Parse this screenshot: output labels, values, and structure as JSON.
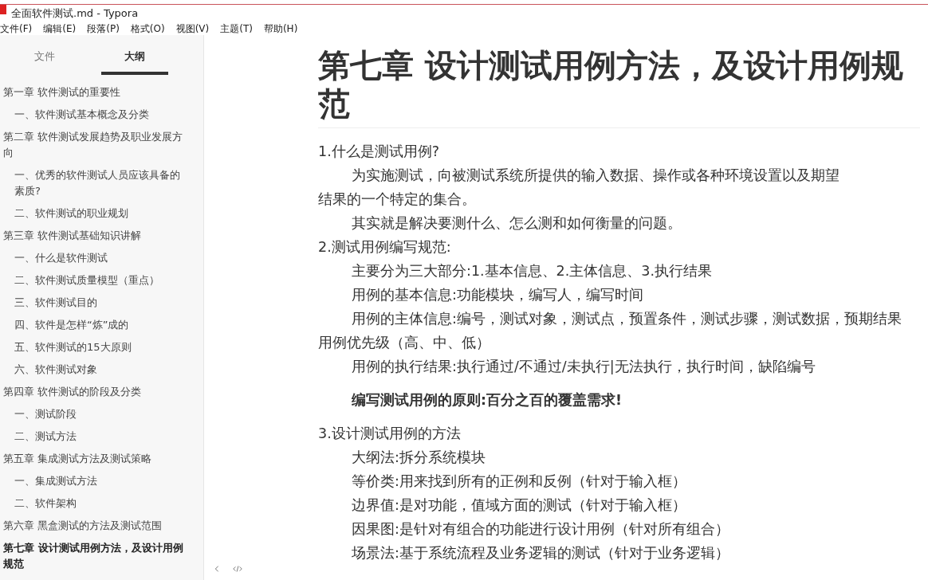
{
  "window": {
    "title": "全面软件测试.md - Typora"
  },
  "menu": [
    "文件(F)",
    "编辑(E)",
    "段落(P)",
    "格式(O)",
    "视图(V)",
    "主题(T)",
    "帮助(H)"
  ],
  "sidebar": {
    "tabs": [
      {
        "label": "文件",
        "selected": false
      },
      {
        "label": "大纲",
        "selected": true
      }
    ],
    "outline": [
      {
        "text": "第一章 软件测试的重要性",
        "selected": false,
        "children": [
          {
            "text": "一、软件测试基本概念及分类",
            "selected": false
          }
        ]
      },
      {
        "text": "第二章 软件测试发展趋势及职业发展方向",
        "selected": false,
        "children": [
          {
            "text": "一、优秀的软件测试人员应该具备的素质?",
            "selected": false
          },
          {
            "text": "二、软件测试的职业规划",
            "selected": false
          }
        ]
      },
      {
        "text": "第三章 软件测试基础知识讲解",
        "selected": false,
        "children": [
          {
            "text": "一、什么是软件测试",
            "selected": false
          },
          {
            "text": "二、软件测试质量模型（重点）",
            "selected": false
          },
          {
            "text": "三、软件测试目的",
            "selected": false
          },
          {
            "text": "四、软件是怎样“炼”成的",
            "selected": false
          },
          {
            "text": "五、软件测试的15大原则",
            "selected": false
          },
          {
            "text": "六、软件测试对象",
            "selected": false
          }
        ]
      },
      {
        "text": "第四章 软件测试的阶段及分类",
        "selected": false,
        "children": [
          {
            "text": "一、测试阶段",
            "selected": false
          },
          {
            "text": "二、测试方法",
            "selected": false
          }
        ]
      },
      {
        "text": "第五章 集成测试方法及测试策略",
        "selected": false,
        "children": [
          {
            "text": "一、集成测试方法",
            "selected": false
          },
          {
            "text": "二、软件架构",
            "selected": false
          }
        ]
      },
      {
        "text": "第六章 黑盒测试的方法及测试范围",
        "selected": false
      },
      {
        "text": "第七章 设计测试用例方法，及设计用例规范",
        "selected": true
      }
    ]
  },
  "document": {
    "heading": "第七章 设计测试用例方法，及设计用例规范",
    "lines": [
      {
        "text": "1.什么是测试用例?",
        "kind": "plain"
      },
      {
        "text": "为实施测试，向被测试系统所提供的输入数据、操作或各种环境设置以及期望",
        "kind": "indent"
      },
      {
        "text": "结果的一个特定的集合。",
        "kind": "plain"
      },
      {
        "text": "其实就是解决要测什么、怎么测和如何衡量的问题。",
        "kind": "indent"
      },
      {
        "text": "2.测试用例编写规范:",
        "kind": "plain"
      },
      {
        "text": "主要分为三大部分:1.基本信息、2.主体信息、3.执行结果",
        "kind": "indent"
      },
      {
        "text": "用例的基本信息:功能模块，编写人，编写时间",
        "kind": "indent"
      },
      {
        "text": "用例的主体信息:编号，测试对象，测试点，预置条件，测试步骤，测试数据，预期结果",
        "kind": "indent"
      },
      {
        "text": "用例优先级（高、中、低）",
        "kind": "plain"
      },
      {
        "text": "用例的执行结果:执行通过/不通过/未执行|无法执行，执行时间，缺陷编号",
        "kind": "indent"
      },
      {
        "text": "编写测试用例的原则:百分之百的覆盖需求!",
        "kind": "bold"
      },
      {
        "text": "3.设计测试用例的方法",
        "kind": "plain"
      },
      {
        "text": "大纲法:拆分系统模块",
        "kind": "indent"
      },
      {
        "text": "等价类:用来找到所有的正例和反例（针对于输入框）",
        "kind": "indent"
      },
      {
        "text": "边界值:是对功能，值域方面的测试（针对于输入框）",
        "kind": "indent"
      },
      {
        "text": "因果图:是针对有组合的功能进行设计用例（针对所有组合）",
        "kind": "indent"
      },
      {
        "text": "场景法:基于系统流程及业务逻辑的测试（针对于业务逻辑）",
        "kind": "indent"
      }
    ]
  }
}
